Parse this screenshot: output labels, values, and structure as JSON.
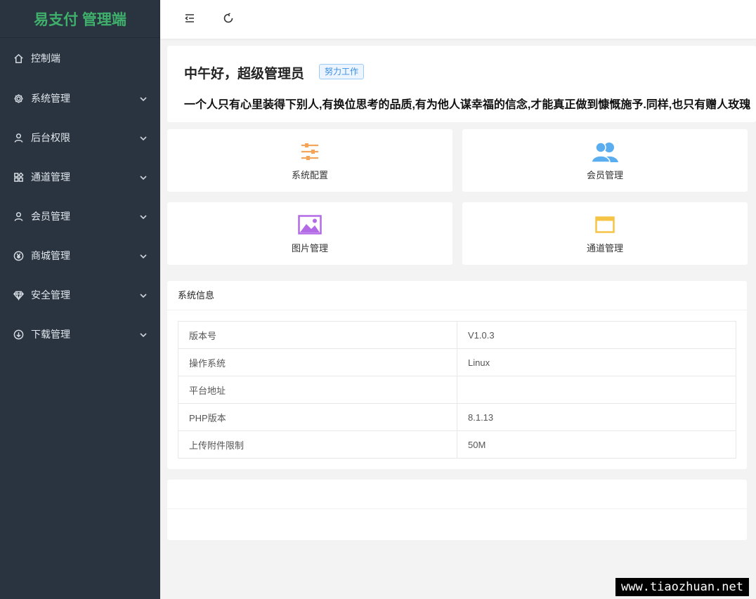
{
  "brand": {
    "title": "易支付 管理端",
    "accent": "#3fb06b"
  },
  "sidebar": {
    "items": [
      {
        "label": "控制端",
        "icon": "home-icon",
        "expandable": false
      },
      {
        "label": "系统管理",
        "icon": "gear-icon",
        "expandable": true
      },
      {
        "label": "后台权限",
        "icon": "user-icon",
        "expandable": true
      },
      {
        "label": "通道管理",
        "icon": "grid-icon",
        "expandable": true
      },
      {
        "label": "会员管理",
        "icon": "user-icon",
        "expandable": true
      },
      {
        "label": "商城管理",
        "icon": "yen-icon",
        "expandable": true
      },
      {
        "label": "安全管理",
        "icon": "diamond-icon",
        "expandable": true
      },
      {
        "label": "下载管理",
        "icon": "download-icon",
        "expandable": true
      }
    ]
  },
  "topbar": {
    "collapse_icon": "menu-fold-icon",
    "refresh_icon": "refresh-icon"
  },
  "welcome": {
    "greeting": "中午好，超级管理员",
    "tag": "努力工作",
    "quote": "一个人只有心里装得下别人,有换位思考的品质,有为他人谋幸福的信念,才能真正做到慷慨施予.同样,也只有赠人玫瑰"
  },
  "quick_links": [
    {
      "label": "系统配置",
      "icon": "sliders-icon",
      "color": "#f5a55a"
    },
    {
      "label": "会员管理",
      "icon": "users-icon",
      "color": "#5aaef0"
    },
    {
      "label": "图片管理",
      "icon": "image-icon",
      "color": "#b36ae6"
    },
    {
      "label": "通道管理",
      "icon": "window-icon",
      "color": "#f5c445"
    }
  ],
  "system_info": {
    "title": "系统信息",
    "rows": [
      {
        "key": "版本号",
        "value": "V1.0.3"
      },
      {
        "key": "操作系统",
        "value": "Linux"
      },
      {
        "key": "平台地址",
        "value": ""
      },
      {
        "key": "PHP版本",
        "value": "8.1.13"
      },
      {
        "key": "上传附件限制",
        "value": "50M"
      }
    ]
  },
  "watermark": "www.tiaozhuan.net"
}
